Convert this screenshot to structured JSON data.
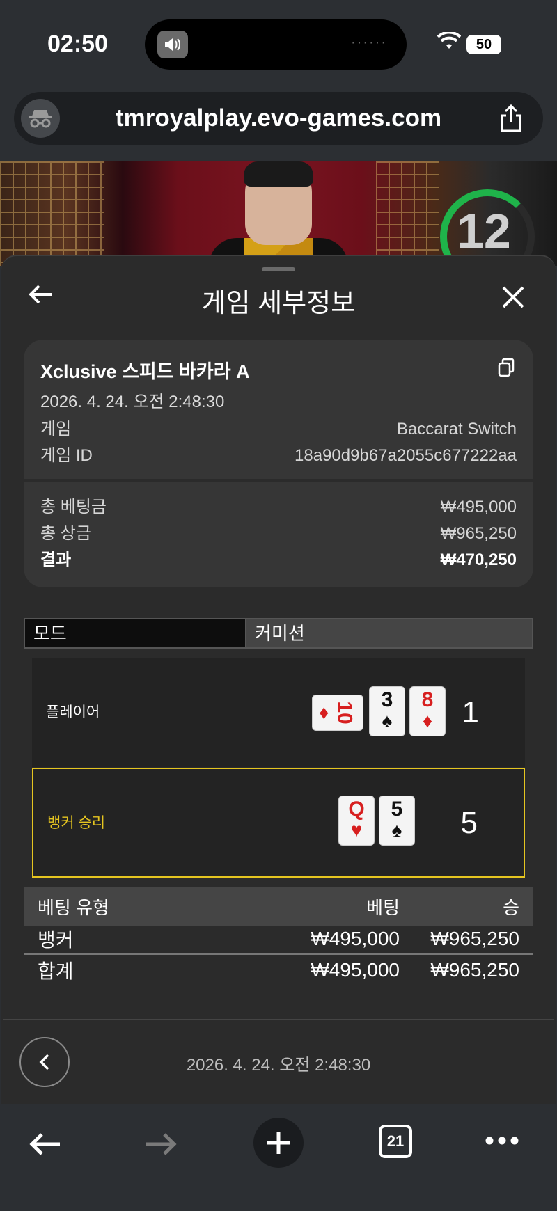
{
  "status_bar": {
    "time": "02:50",
    "battery": "50"
  },
  "browser": {
    "url": "tmroyalplay.evo-games.com",
    "tab_count": "21"
  },
  "video": {
    "timer": "12"
  },
  "header": {
    "title": "게임 세부정보"
  },
  "summary": {
    "name": "Xclusive 스피드 바카라 A",
    "date": "2026. 4. 24. 오전 2:48:30",
    "game_label": "게임",
    "game_value": "Baccarat Switch",
    "game_id_label": "게임 ID",
    "game_id_value": "18a90d9b67a2055c677222aa",
    "total_bet_label": "총 베팅금",
    "total_bet_value": "₩495,000",
    "total_win_label": "총 상금",
    "total_win_value": "₩965,250",
    "result_label": "결과",
    "result_value": "₩470,250"
  },
  "mode": {
    "label": "모드",
    "value": "커미션"
  },
  "hands": {
    "player": {
      "label": "플레이어",
      "score": "1",
      "cards": [
        {
          "rank": "10",
          "suit": "♦",
          "color": "red",
          "sideways": true
        },
        {
          "rank": "3",
          "suit": "♠",
          "color": "black"
        },
        {
          "rank": "8",
          "suit": "♦",
          "color": "red"
        }
      ]
    },
    "banker": {
      "label": "뱅커 승리",
      "score": "5",
      "cards": [
        {
          "rank": "Q",
          "suit": "♥",
          "color": "red"
        },
        {
          "rank": "5",
          "suit": "♠",
          "color": "black"
        }
      ]
    }
  },
  "bets": {
    "headers": {
      "type": "베팅 유형",
      "bet": "베팅",
      "win": "승"
    },
    "rows": [
      {
        "type": "뱅커",
        "bet": "₩495,000",
        "win": "₩965,250"
      },
      {
        "type": "합계",
        "bet": "₩495,000",
        "win": "₩965,250"
      }
    ]
  },
  "footer": {
    "date": "2026. 4. 24. 오전 2:48:30"
  },
  "colors": {
    "accent_yellow": "#e5c520",
    "timer_green": "#1fb34a",
    "card_red": "#d71f1f"
  }
}
